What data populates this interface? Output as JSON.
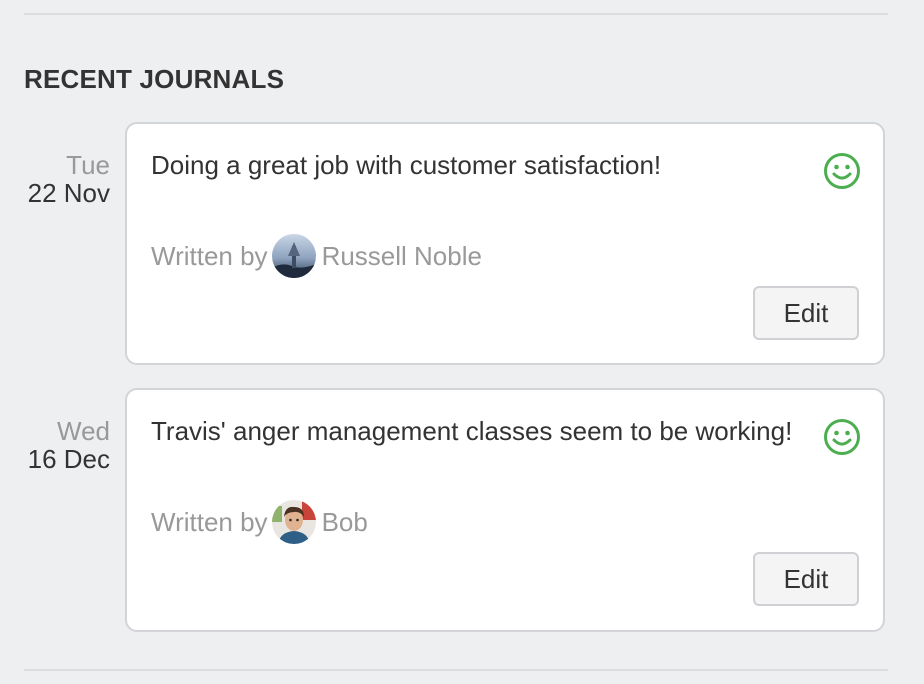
{
  "section": {
    "title": "RECENT JOURNALS"
  },
  "journals": [
    {
      "day_of_week": "Tue",
      "date": "22 Nov",
      "text": "Doing a great job with customer satisfaction!",
      "written_by_label": "Written by",
      "author": "Russell Noble",
      "mood_icon": "smiley-icon",
      "edit_label": "Edit"
    },
    {
      "day_of_week": "Wed",
      "date": "16 Dec",
      "text": "Travis' anger management classes seem to be working!",
      "written_by_label": "Written by",
      "author": "Bob",
      "mood_icon": "smiley-icon",
      "edit_label": "Edit"
    }
  ],
  "colors": {
    "background": "#eeeff1",
    "card": "#ffffff",
    "smiley": "#4cae4f",
    "muted_text": "#999999",
    "primary_text": "#333333"
  }
}
